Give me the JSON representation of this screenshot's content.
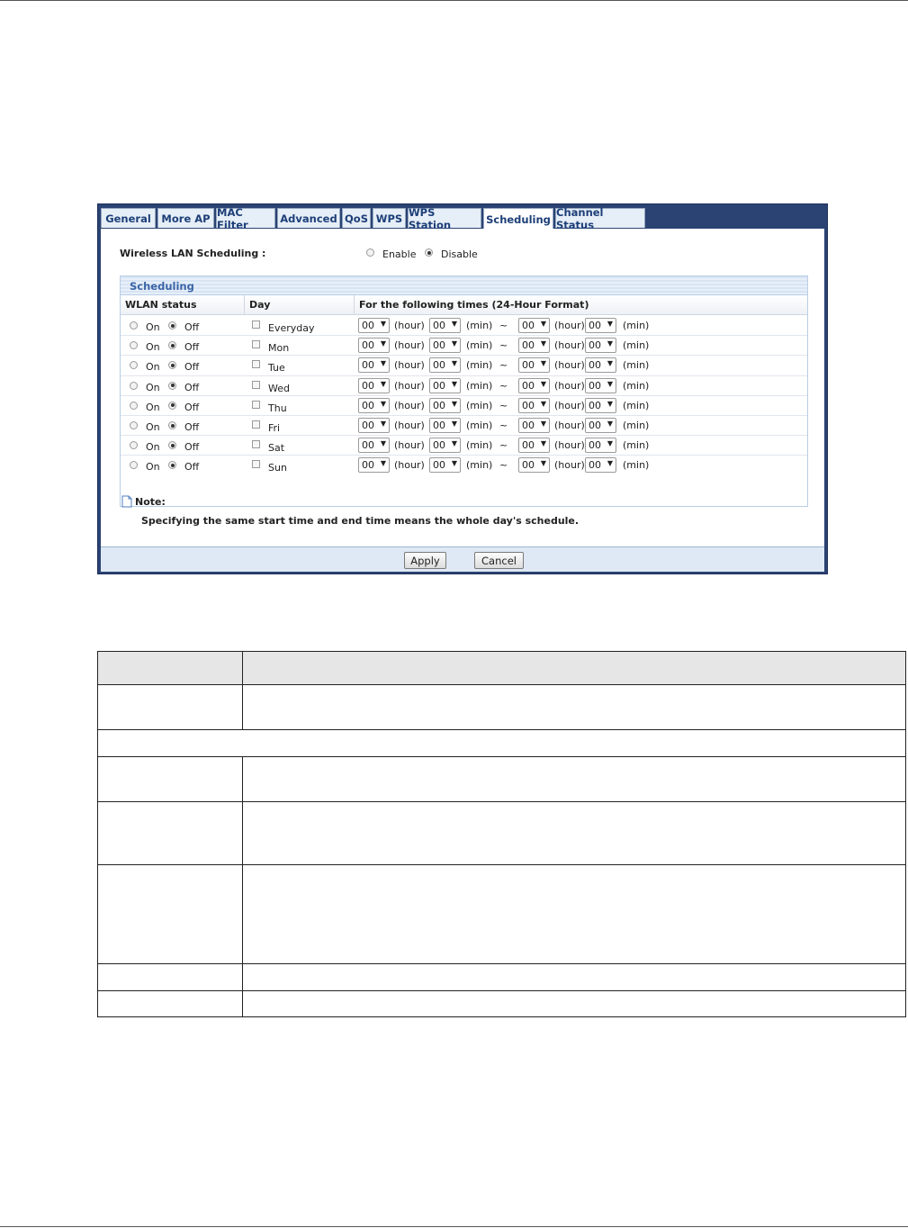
{
  "tabs": [
    "General",
    "More AP",
    "MAC Filter",
    "Advanced",
    "QoS",
    "WPS",
    "WPS Station",
    "Scheduling",
    "Channel Status"
  ],
  "active_tab": "Scheduling",
  "wlan_scheduling": {
    "label": "Wireless LAN Scheduling :",
    "enable_label": "Enable",
    "disable_label": "Disable",
    "selected": "Disable"
  },
  "scheduling": {
    "section_title": "Scheduling",
    "columns": {
      "status": "WLAN status",
      "day": "Day",
      "times": "For the following times (24-Hour Format)"
    },
    "on_label": "On",
    "off_label": "Off",
    "hour_label": "(hour)",
    "min_label": "(min)",
    "range_sep": "~",
    "rows": [
      {
        "day": "Everyday",
        "status": "Off",
        "checked": false,
        "start_hour": "00",
        "start_min": "00",
        "end_hour": "00",
        "end_min": "00"
      },
      {
        "day": "Mon",
        "status": "Off",
        "checked": false,
        "start_hour": "00",
        "start_min": "00",
        "end_hour": "00",
        "end_min": "00"
      },
      {
        "day": "Tue",
        "status": "Off",
        "checked": false,
        "start_hour": "00",
        "start_min": "00",
        "end_hour": "00",
        "end_min": "00"
      },
      {
        "day": "Wed",
        "status": "Off",
        "checked": false,
        "start_hour": "00",
        "start_min": "00",
        "end_hour": "00",
        "end_min": "00"
      },
      {
        "day": "Thu",
        "status": "Off",
        "checked": false,
        "start_hour": "00",
        "start_min": "00",
        "end_hour": "00",
        "end_min": "00"
      },
      {
        "day": "Fri",
        "status": "Off",
        "checked": false,
        "start_hour": "00",
        "start_min": "00",
        "end_hour": "00",
        "end_min": "00"
      },
      {
        "day": "Sat",
        "status": "Off",
        "checked": false,
        "start_hour": "00",
        "start_min": "00",
        "end_hour": "00",
        "end_min": "00"
      },
      {
        "day": "Sun",
        "status": "Off",
        "checked": false,
        "start_hour": "00",
        "start_min": "00",
        "end_hour": "00",
        "end_min": "00"
      }
    ]
  },
  "note": {
    "title": "Note:",
    "text": "Specifying the same start time and end time means the whole day's schedule."
  },
  "buttons": {
    "apply": "Apply",
    "cancel": "Cancel"
  },
  "colors": {
    "frame_navy": "#2b4372",
    "tab_text": "#1d3f78",
    "section_title": "#3a64a6"
  }
}
